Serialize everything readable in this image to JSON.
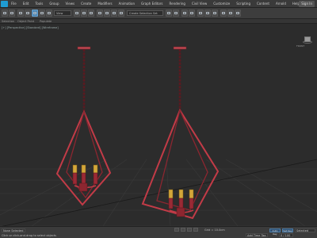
{
  "menubar": {
    "items": [
      "File",
      "Edit",
      "Tools",
      "Group",
      "Views",
      "Create",
      "Modifiers",
      "Animation",
      "Graph Editors",
      "Rendering",
      "Civil View",
      "Customize",
      "Scripting",
      "Content",
      "Arnold",
      "Help"
    ],
    "signin_label": "Sign In"
  },
  "toolbar": {
    "view_dropdown": "View",
    "selection_set": "Create Selection Set"
  },
  "ribbon": {
    "items": [
      "Selection",
      "Object Paint",
      "Populate"
    ]
  },
  "viewport": {
    "label": "[+] [Perspective] [Standard] [Wireframe]",
    "viewcube_label": "FRONT"
  },
  "status": {
    "selection_count": "None Selected",
    "prompt": "Click or click-and-drag to select objects",
    "grid_label": "Grid = 10.0cm",
    "add_time_tag": "Add Time Tag",
    "frame_counter": "0 / 100",
    "auto_key": "Auto Key",
    "set_key": "Set Key",
    "selected_label": "Selected"
  }
}
